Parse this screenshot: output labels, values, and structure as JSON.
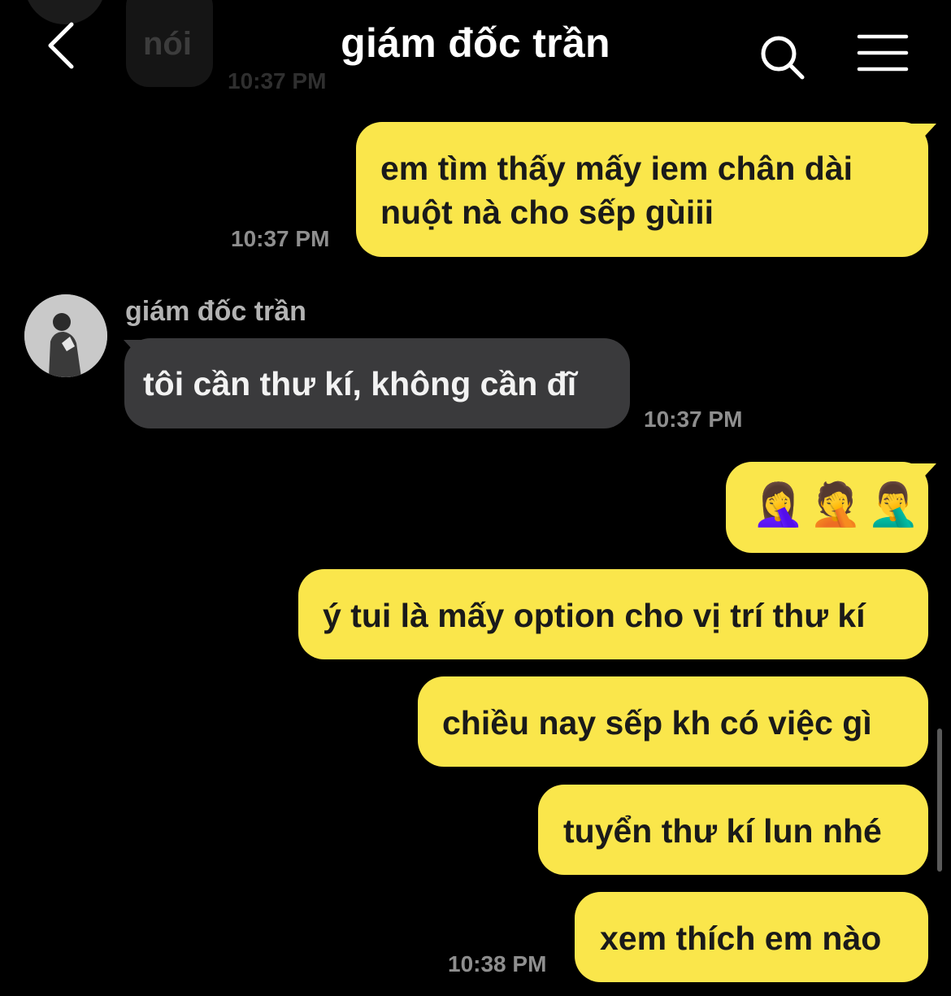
{
  "previous_message": {
    "text": "nói",
    "time": "10:37 PM"
  },
  "header": {
    "title": "giám đốc trần",
    "back_icon": "chevron-left-icon",
    "search_icon": "search-icon",
    "menu_icon": "hamburger-menu-icon"
  },
  "colors": {
    "background": "#000000",
    "my_bubble": "#fae64b",
    "their_bubble": "#3a3a3c",
    "timestamp": "#8e8e8e"
  },
  "messages": [
    {
      "sender": "me",
      "text_line1": "em tìm thấy mấy iem chân dài",
      "text_line2": "nuột nà cho sếp gùiii",
      "time": "10:37 PM"
    },
    {
      "sender": "them",
      "sender_name": "giám đốc trần",
      "text": "tôi cần thư kí, không cần đĩ",
      "time": "10:37 PM"
    },
    {
      "sender": "me",
      "text": "🤦‍♀️🤦🤦‍♂️"
    },
    {
      "sender": "me",
      "text": "ý tui là mấy option cho vị trí thư kí"
    },
    {
      "sender": "me",
      "text": "chiều nay sếp kh có việc gì"
    },
    {
      "sender": "me",
      "text": "tuyển thư kí lun nhé"
    },
    {
      "sender": "me",
      "text": "xem thích em nào",
      "time": "10:38 PM"
    }
  ]
}
